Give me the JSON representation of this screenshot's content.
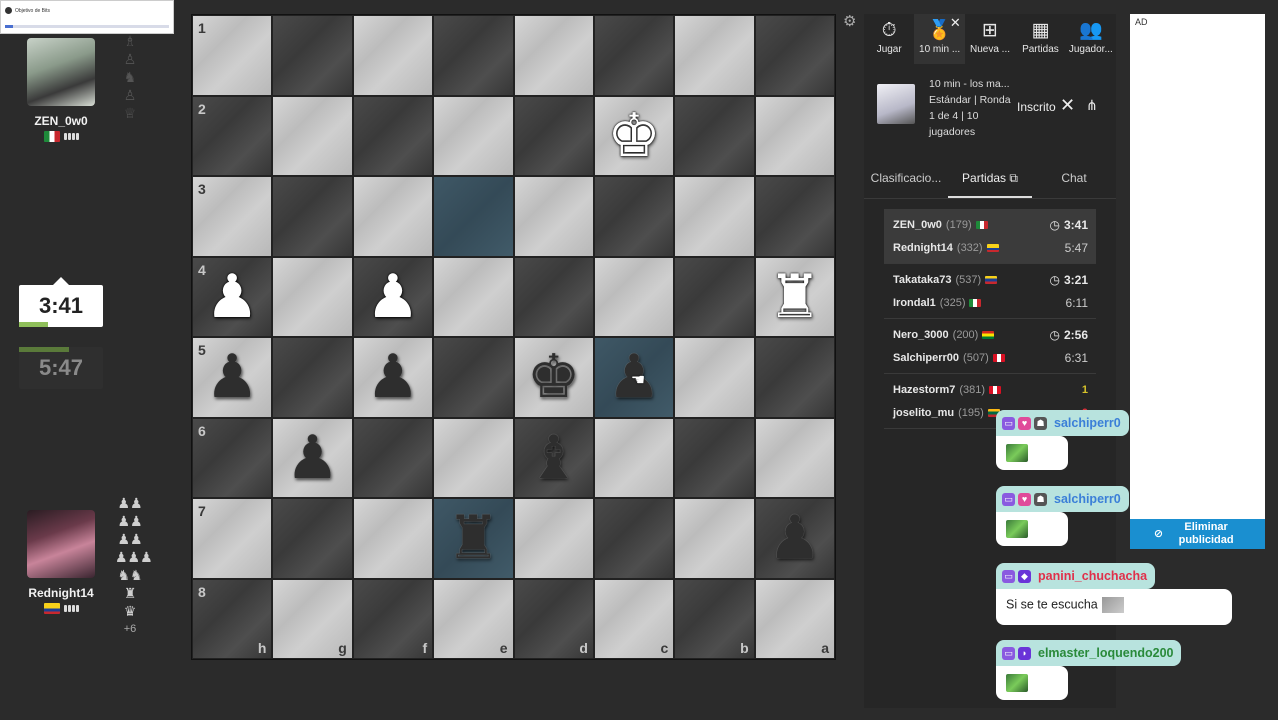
{
  "objective": {
    "title": "Objetivo de Bits",
    "progress_percent": 5
  },
  "top_player": {
    "name": "ZEN_0w0",
    "captured": [
      "♗",
      "♙",
      "♞",
      "♙",
      "♕"
    ]
  },
  "bottom_player": {
    "name": "Rednight14",
    "captured": [
      "♟♟",
      "♟♟",
      "♟♟",
      "♟♟♟",
      "♞♞",
      "♜",
      "♛"
    ],
    "captured_more": "+6"
  },
  "clocks": {
    "active": "3:41",
    "inactive": "5:47",
    "active_level_percent": 35,
    "inactive_level_percent": 60
  },
  "board": {
    "rank_labels": [
      "1",
      "2",
      "3",
      "4",
      "5",
      "6",
      "7",
      "8"
    ],
    "file_labels": [
      "h",
      "g",
      "f",
      "e",
      "d",
      "c",
      "b",
      "a"
    ]
  },
  "nav_tabs": [
    {
      "label": "Jugar",
      "icon": "⏱"
    },
    {
      "label": "10 min ...",
      "icon": "🏅"
    },
    {
      "label": "Nueva ...",
      "icon": "⊞"
    },
    {
      "label": "Partidas",
      "icon": "▦"
    },
    {
      "label": "Jugador...",
      "icon": "👥"
    }
  ],
  "tournament": {
    "title": "10 min - los ma...",
    "line2": "Estándar | Ronda",
    "line3": "1 de 4 | 10",
    "line4": "jugadores",
    "status": "Inscrito"
  },
  "subtabs": [
    "Clasificacio...",
    "Partidas",
    "Chat"
  ],
  "games": [
    {
      "p1": {
        "name": "ZEN_0w0",
        "rating": "(179)",
        "flag": "mx",
        "value": "3:41",
        "kind": "clock"
      },
      "p2": {
        "name": "Rednight14",
        "rating": "(332)",
        "flag": "co",
        "value": "5:47",
        "kind": "time"
      }
    },
    {
      "p1": {
        "name": "Takataka73",
        "rating": "(537)",
        "flag": "ve",
        "value": "3:21",
        "kind": "clock"
      },
      "p2": {
        "name": "Irondal1",
        "rating": "(325)",
        "flag": "mx",
        "value": "6:11",
        "kind": "time"
      }
    },
    {
      "p1": {
        "name": "Nero_3000",
        "rating": "(200)",
        "flag": "bo",
        "value": "2:56",
        "kind": "clock"
      },
      "p2": {
        "name": "Salchiperr00",
        "rating": "(507)",
        "flag": "pe",
        "value": "6:31",
        "kind": "time"
      }
    },
    {
      "p1": {
        "name": "Hazestorm7",
        "rating": "(381)",
        "flag": "pe",
        "value": "1",
        "kind": "score"
      },
      "p2": {
        "name": "joselito_mu",
        "rating": "(195)",
        "flag": "lt",
        "value": "0",
        "kind": "score"
      }
    }
  ],
  "ad": {
    "label": "AD",
    "remove_button": "Eliminar publicidad"
  },
  "chat_messages": [
    {
      "user": "salchiperr0",
      "user_color": "#3b7fd8",
      "text": ""
    },
    {
      "user": "salchiperr0",
      "user_color": "#3b7fd8",
      "text": ""
    },
    {
      "user": "panini_chuchacha",
      "user_color": "#e0304a",
      "text": "Si se te escucha"
    },
    {
      "user": "elmaster_loquendo200",
      "user_color": "#2a8a3a",
      "text": ""
    }
  ],
  "colors": {
    "highlight_square": "#3f5866",
    "chat_header": "#b8e3de",
    "ad_button": "#1a8fd0",
    "clock_bar": "#8fbf5a"
  }
}
